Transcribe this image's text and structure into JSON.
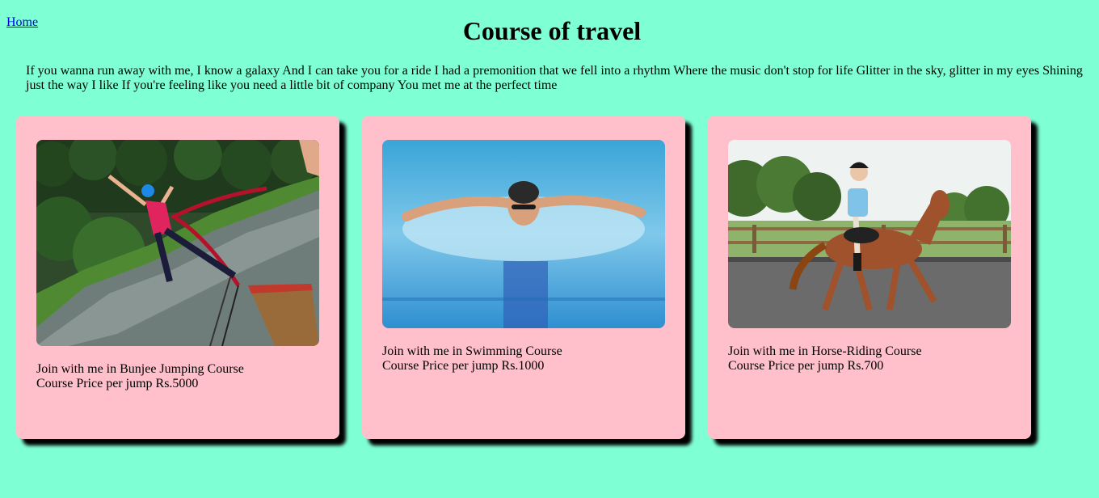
{
  "nav": {
    "home_label": "Home"
  },
  "page": {
    "title": "Course of travel",
    "intro": "If you wanna run away with me, I know a galaxy And I can take you for a ride I had a premonition that we fell into a rhythm Where the music don't stop for life Glitter in the sky, glitter in my eyes Shining just the way I like If you're feeling like you need a little bit of company You met me at the perfect time"
  },
  "cards": [
    {
      "title": "Join with me in Bunjee Jumping Course",
      "price": "Course Price per jump Rs.5000",
      "image": "bungee-jumping-photo"
    },
    {
      "title": "Join with me in Swimming Course",
      "price": "Course Price per jump Rs.1000",
      "image": "swimming-photo"
    },
    {
      "title": "Join with me in Horse-Riding Course",
      "price": "Course Price per jump Rs.700",
      "image": "horse-riding-photo"
    }
  ],
  "colors": {
    "background": "#7fffd4",
    "card": "#ffc0cb",
    "shadow": "#000000",
    "link": "#0000ee"
  }
}
